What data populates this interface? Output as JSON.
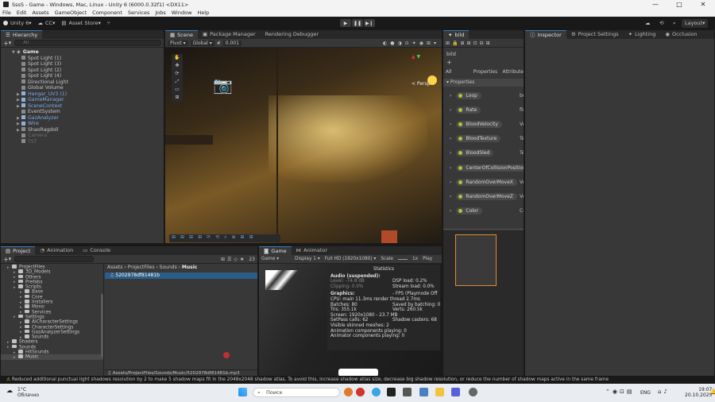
{
  "window": {
    "title": "SssS - Game - Windows, Mac, Linux - Unity 6 (6000.0.32f1) <DX11>",
    "minimize": "—",
    "maximize": "□",
    "close": "✕"
  },
  "menu": [
    "File",
    "Edit",
    "Assets",
    "GameObject",
    "Component",
    "Services",
    "Jobs",
    "Window",
    "Help"
  ],
  "toolbar": {
    "account": "Unity 6",
    "cloud": "CC",
    "asset_store": "Asset Store",
    "layout": "Layout"
  },
  "hierarchy": {
    "tab": "Hierarchy",
    "add": "+",
    "search_placeholder": "All",
    "root": "Game",
    "items": [
      {
        "label": "Spot Light (1)",
        "type": "grey"
      },
      {
        "label": "Spot Light (3)",
        "type": "grey"
      },
      {
        "label": "Spot Light (2)",
        "type": "grey"
      },
      {
        "label": "Spot Light (4)",
        "type": "grey"
      },
      {
        "label": "Directional Light",
        "type": "grey"
      },
      {
        "label": "Global Volume",
        "type": "grey"
      },
      {
        "label": "Hangar_UV3 (1)",
        "type": "blue",
        "expand": true
      },
      {
        "label": "GameManager",
        "type": "blue",
        "expand": true
      },
      {
        "label": "SceneContext",
        "type": "blue",
        "expand": true
      },
      {
        "label": "EventSystem",
        "type": "grey"
      },
      {
        "label": "GazAnalyzer",
        "type": "blue",
        "expand": true
      },
      {
        "label": "Wire",
        "type": "blue",
        "expand": true
      },
      {
        "label": "ShaoRagdoll",
        "type": "grey",
        "expand": true
      },
      {
        "label": "Camera",
        "type": "dim"
      },
      {
        "label": "TST",
        "type": "dim"
      }
    ]
  },
  "scene": {
    "tabs": [
      "Scene",
      "Package Manager",
      "Rendering Debugger"
    ],
    "pivot": "Pivot",
    "global": "Global",
    "snap": "0.001",
    "persp": "< Persp"
  },
  "bild": {
    "tab": "bild",
    "title": "bild",
    "add": "+",
    "filters": [
      "All",
      "Properties",
      "Attribute"
    ],
    "section": "Properties",
    "properties": [
      {
        "name": "Loop",
        "type": "bool"
      },
      {
        "name": "Rate",
        "type": "float"
      },
      {
        "name": "BloodVelocity",
        "type": "Vector3"
      },
      {
        "name": "BloodTexture",
        "type": "Texture2D"
      },
      {
        "name": "BloodSled",
        "type": "Texture2D"
      },
      {
        "name": "CenterOfCollisionPosition",
        "type": ""
      },
      {
        "name": "RandomOverMoveX",
        "type": "Vector"
      },
      {
        "name": "RandomOverMoveZ",
        "type": "Vecto"
      },
      {
        "name": "Color",
        "type": "Color"
      }
    ]
  },
  "inspector": {
    "tabs": [
      "Inspector",
      "Project Settings",
      "Lighting",
      "Occlusion"
    ]
  },
  "project": {
    "tabs": [
      "Project",
      "Animation",
      "Console"
    ],
    "add": "+",
    "breadcrumb": [
      "Assets",
      "ProjectFiles",
      "Sounds",
      "Music"
    ],
    "count": "23",
    "tree": [
      {
        "label": "ProjectFiles",
        "depth": 0
      },
      {
        "label": "3D_Models",
        "depth": 1
      },
      {
        "label": "Others",
        "depth": 1
      },
      {
        "label": "Prefabs",
        "depth": 1
      },
      {
        "label": "Scripts",
        "depth": 1
      },
      {
        "label": "Base",
        "depth": 2
      },
      {
        "label": "Core",
        "depth": 2
      },
      {
        "label": "Installers",
        "depth": 2
      },
      {
        "label": "Mono",
        "depth": 2
      },
      {
        "label": "Services",
        "depth": 2
      },
      {
        "label": "Settings",
        "depth": 1
      },
      {
        "label": "AICharacterSettings",
        "depth": 2
      },
      {
        "label": "CharacterSettings",
        "depth": 2
      },
      {
        "label": "GazAnalyzerSettings",
        "depth": 2
      },
      {
        "label": "Sounds",
        "depth": 2
      },
      {
        "label": "Shaders",
        "depth": 0
      },
      {
        "label": "Sounds",
        "depth": 0
      },
      {
        "label": "HitSounds",
        "depth": 1
      },
      {
        "label": "Music",
        "depth": 1
      }
    ],
    "file": "5202978df81481b",
    "footer_path": "Assets/ProjectFiles/Sounds/Music/5202978df81481b.mp3"
  },
  "game": {
    "tabs": [
      "Game",
      "Animator"
    ],
    "mode": "Game",
    "display": "Display 1",
    "resolution": "Full HD (1920x1080)",
    "scale_label": "Scale",
    "scale": "1x",
    "play": "Play"
  },
  "statistics": {
    "title": "Statistics",
    "audio_header": "Audio (suspended):",
    "level": "Level: -74.8 dB",
    "clipping": "Clipping: 0.0%",
    "dsp": "DSP load: 0.2%",
    "stream": "Stream load: 0.0%",
    "graphics_header": "Graphics:",
    "fps": "- FPS (Playmode Off",
    "rows": [
      [
        "CPU: main 11.3ms  render thread 2.7ms",
        ""
      ],
      [
        "Batches: 80",
        "Saved by batching: 0"
      ],
      [
        "Tris: 355.1k",
        "Verts: 260.5k"
      ],
      [
        "Screen: 1920x1080 - 23.7 MB",
        ""
      ],
      [
        "SetPass calls: 62",
        "Shadow casters: 68"
      ],
      [
        "Visible skinned meshes: 2",
        ""
      ],
      [
        "Animation components playing: 0",
        ""
      ],
      [
        "Animator components playing: 0",
        ""
      ]
    ]
  },
  "status_message": "Reduced additional punctual light shadows resolution by 2 to make 5 shadow maps fit in the 2048x2048 shadow atlas. To avoid this, increase shadow atlas size, decrease big shadow resolution, or reduce the number of shadow maps active in the same frame",
  "taskbar": {
    "weather_temp": "1°C",
    "weather_desc": "Облачно",
    "search": "Поиск",
    "lang": "ENG",
    "time": "19:07",
    "date": "20.10.2025"
  },
  "colors": {
    "accent": "#3a79bb",
    "selection": "#2c5d87",
    "panel": "#383838",
    "dark": "#191919",
    "property_dot": "#a7c83c"
  }
}
